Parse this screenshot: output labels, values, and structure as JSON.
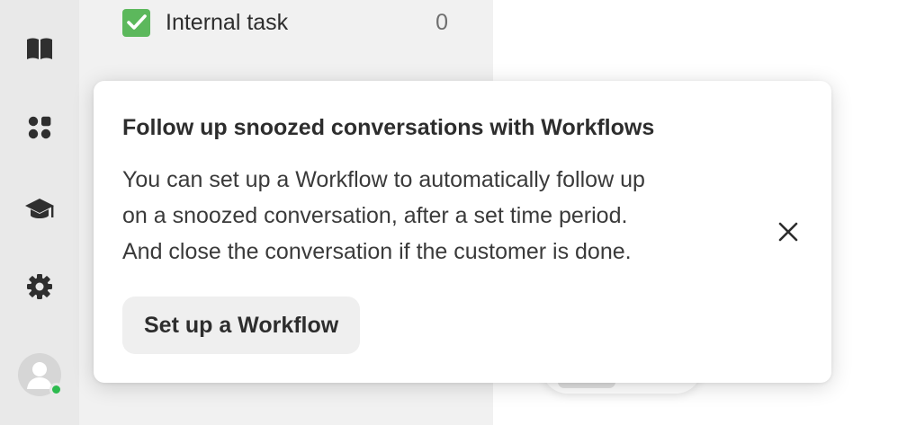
{
  "sidebar": {
    "icons": [
      {
        "name": "book-icon"
      },
      {
        "name": "apps-grid-icon"
      },
      {
        "name": "graduation-cap-icon"
      },
      {
        "name": "gear-icon"
      }
    ],
    "avatar": {
      "status": "online",
      "status_color": "#2dbb4f"
    }
  },
  "panel": {
    "task": {
      "label": "Internal task",
      "count": "0",
      "checked": true,
      "check_color": "#5cb85c"
    }
  },
  "popover": {
    "title": "Follow up snoozed conversations with Workflows",
    "body_lines": [
      "You can set up a Workflow to automatically follow up",
      "on a snoozed conversation, after a set time period.",
      "And close the conversation if the customer is done."
    ],
    "cta_label": "Set up a Workflow"
  }
}
